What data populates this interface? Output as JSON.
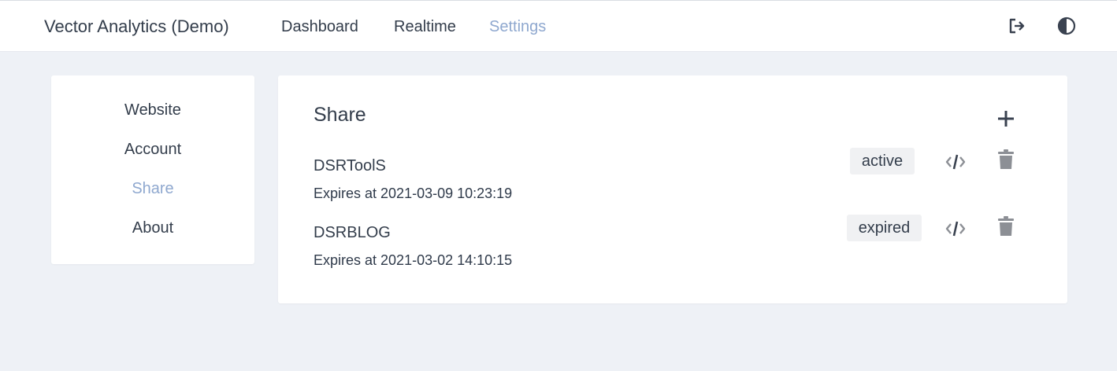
{
  "header": {
    "brand": "Vector Analytics (Demo)",
    "nav": [
      {
        "label": "Dashboard"
      },
      {
        "label": "Realtime"
      },
      {
        "label": "Settings",
        "active": true
      }
    ],
    "icons": [
      "logout-icon",
      "theme-toggle-icon"
    ]
  },
  "sidebar": {
    "items": [
      {
        "label": "Website"
      },
      {
        "label": "Account"
      },
      {
        "label": "Share",
        "active": true
      },
      {
        "label": "About"
      }
    ]
  },
  "share": {
    "title": "Share",
    "add_icon": "plus-icon",
    "rows": [
      {
        "name": "DSRToolS",
        "status": "active",
        "expires": "Expires at 2021-03-09 10:23:19"
      },
      {
        "name": "DSRBLOG",
        "status": "expired",
        "expires": "Expires at 2021-03-02 14:10:15"
      }
    ]
  },
  "colors": {
    "accent": "#8fa8cf",
    "text": "#333d4b",
    "background": "#eef1f6",
    "icon_gray": "#8c8f95"
  }
}
